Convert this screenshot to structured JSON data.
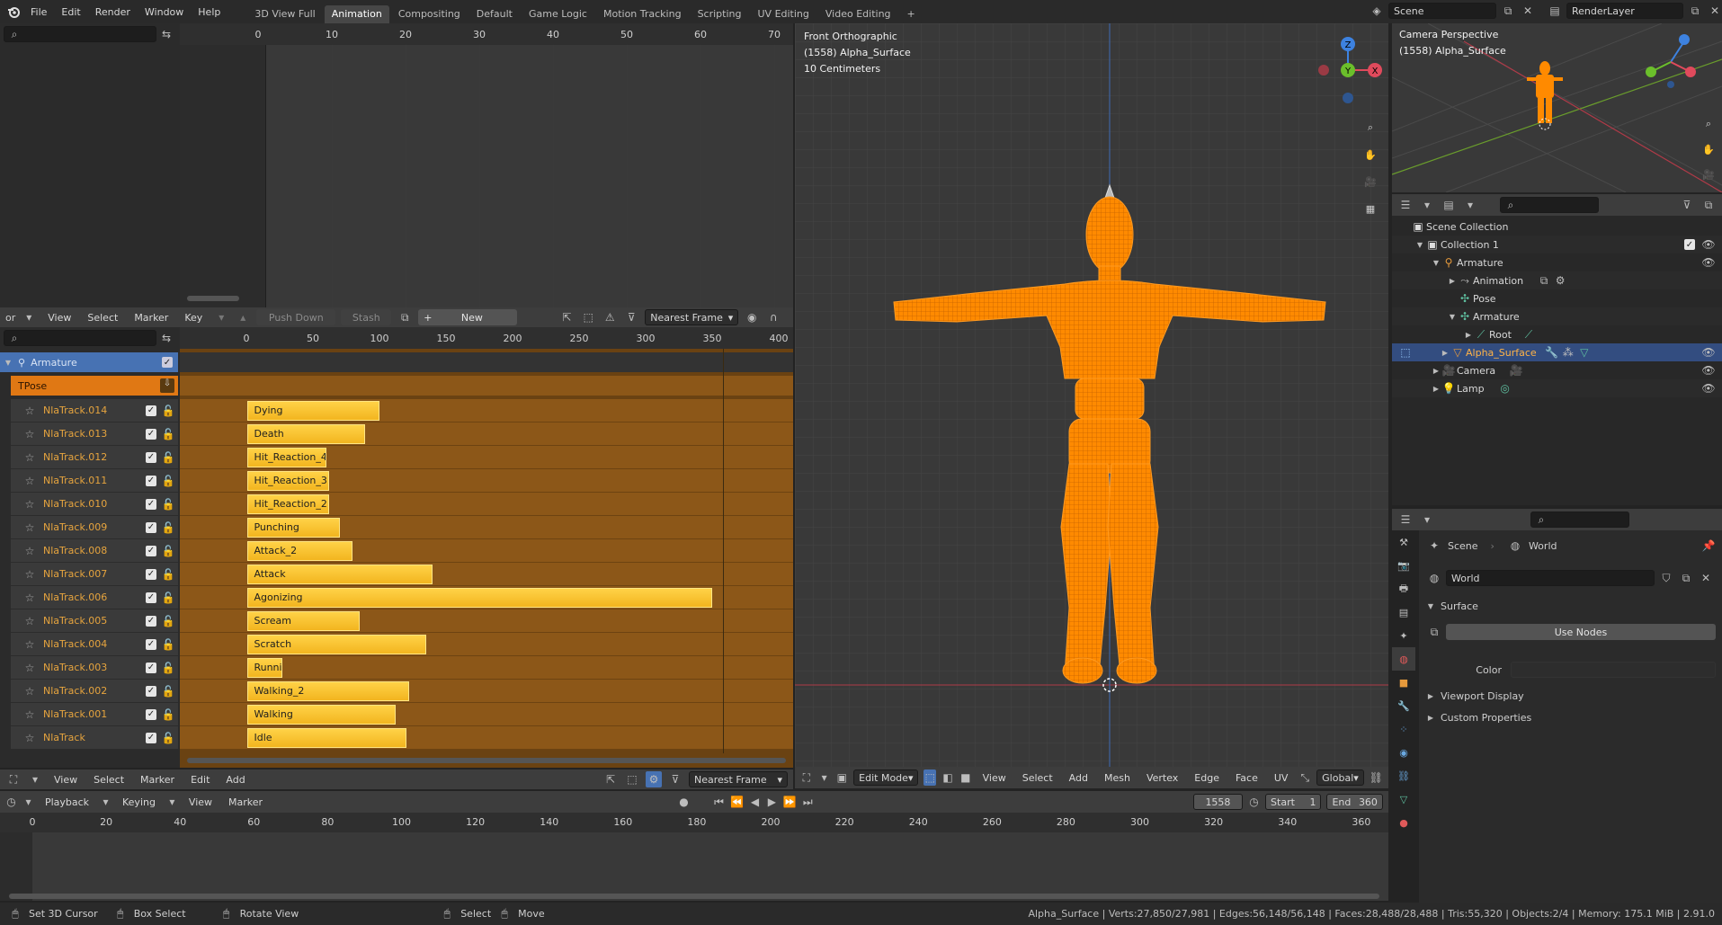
{
  "topbar": {
    "menus": [
      "File",
      "Edit",
      "Render",
      "Window",
      "Help"
    ],
    "workspaces": [
      "3D View Full",
      "Animation",
      "Compositing",
      "Default",
      "Game Logic",
      "Motion Tracking",
      "Scripting",
      "UV Editing",
      "Video Editing"
    ],
    "active_workspace": "Animation",
    "add_tab": "+",
    "scene": "Scene",
    "view_layer": "RenderLayer"
  },
  "dopesheet": {
    "search_placeholder": "",
    "ruler": [
      "0",
      "10",
      "20",
      "30",
      "40",
      "50",
      "60",
      "70"
    ]
  },
  "nla": {
    "header_left": "or",
    "menus": [
      "View",
      "Select",
      "Marker",
      "Key"
    ],
    "push_down": "Push Down",
    "stash": "Stash",
    "new_label": "New",
    "snap": "Nearest Frame",
    "ruler": [
      "0",
      "50",
      "100",
      "150",
      "200",
      "250",
      "300",
      "350",
      "400"
    ],
    "armature_label": "Armature",
    "tpose_label": "TPose",
    "tracks": [
      {
        "name": "NlaTrack.014",
        "strip": "Dying",
        "start": 1,
        "end": 100
      },
      {
        "name": "NlaTrack.013",
        "strip": "Death",
        "start": 1,
        "end": 89
      },
      {
        "name": "NlaTrack.012",
        "strip": "Hit_Reaction_4",
        "start": 1,
        "end": 60
      },
      {
        "name": "NlaTrack.011",
        "strip": "Hit_Reaction_3",
        "start": 1,
        "end": 62
      },
      {
        "name": "NlaTrack.010",
        "strip": "Hit_Reaction_2",
        "start": 1,
        "end": 62
      },
      {
        "name": "NlaTrack.009",
        "strip": "Punching",
        "start": 1,
        "end": 70
      },
      {
        "name": "NlaTrack.008",
        "strip": "Attack_2",
        "start": 1,
        "end": 80
      },
      {
        "name": "NlaTrack.007",
        "strip": "Attack",
        "start": 1,
        "end": 140
      },
      {
        "name": "NlaTrack.006",
        "strip": "Agonizing",
        "start": 1,
        "end": 350
      },
      {
        "name": "NlaTrack.005",
        "strip": "Scream",
        "start": 1,
        "end": 85
      },
      {
        "name": "NlaTrack.004",
        "strip": "Scratch",
        "start": 1,
        "end": 135
      },
      {
        "name": "NlaTrack.003",
        "strip": "Running",
        "start": 1,
        "end": 27
      },
      {
        "name": "NlaTrack.002",
        "strip": "Walking_2",
        "start": 1,
        "end": 122
      },
      {
        "name": "NlaTrack.001",
        "strip": "Walking",
        "start": 1,
        "end": 112
      },
      {
        "name": "NlaTrack",
        "strip": "Idle",
        "start": 1,
        "end": 120
      }
    ],
    "footer_menus": [
      "View",
      "Select",
      "Marker",
      "Edit",
      "Add"
    ],
    "footer_snap": "Nearest Frame"
  },
  "viewport": {
    "view_name": "Front Orthographic",
    "object_info": "(1558) Alpha_Surface",
    "scale": "10 Centimeters",
    "mode": "Edit Mode",
    "menus": [
      "View",
      "Select",
      "Add",
      "Mesh",
      "Vertex",
      "Edge",
      "Face",
      "UV"
    ],
    "orientation": "Global",
    "gizmo": {
      "x": "X",
      "y": "Y",
      "z": "Z"
    }
  },
  "camera_view": {
    "view_name": "Camera Perspective",
    "object_info": "(1558) Alpha_Surface"
  },
  "outliner": {
    "items": [
      {
        "label": "Scene Collection"
      },
      {
        "label": "Collection 1"
      },
      {
        "label": "Armature"
      },
      {
        "label": "Animation"
      },
      {
        "label": "Pose"
      },
      {
        "label": "Armature"
      },
      {
        "label": "Root"
      },
      {
        "label": "Alpha_Surface"
      },
      {
        "label": "Camera"
      },
      {
        "label": "Lamp"
      }
    ]
  },
  "properties": {
    "breadcrumb_scene": "Scene",
    "breadcrumb_world": "World",
    "world_field": "World",
    "surface_label": "Surface",
    "use_nodes": "Use Nodes",
    "color_label": "Color",
    "viewport_display": "Viewport Display",
    "custom_properties": "Custom Properties"
  },
  "timeline": {
    "menus": [
      "Playback",
      "Keying",
      "View",
      "Marker"
    ],
    "current_frame": "1558",
    "start_label": "Start",
    "start_value": "1",
    "end_label": "End",
    "end_value": "360",
    "ruler": [
      "0",
      "20",
      "40",
      "60",
      "80",
      "100",
      "120",
      "140",
      "160",
      "180",
      "200",
      "220",
      "240",
      "260",
      "280",
      "300",
      "320",
      "340",
      "360"
    ]
  },
  "statusbar": {
    "set_cursor": "Set 3D Cursor",
    "box_select": "Box Select",
    "rotate_view": "Rotate View",
    "select": "Select",
    "move": "Move",
    "stats": "Alpha_Surface | Verts:27,850/27,981 | Edges:56,148/56,148 | Faces:28,488/28,488 | Tris:55,320 | Objects:2/4 | Memory: 175.1 MiB | 2.91.0"
  },
  "colors": {
    "accent_blue": "#4772b3",
    "strip_yellow": "#f2b51f",
    "track_orange": "#e6a43e",
    "mesh_orange": "#ff8a00"
  }
}
